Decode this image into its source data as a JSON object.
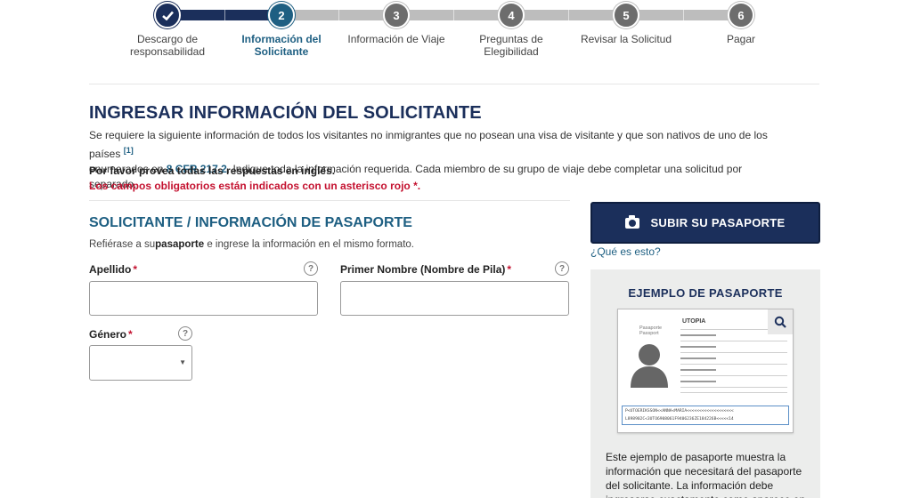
{
  "stepper": {
    "steps": [
      {
        "number": "1",
        "label_line1": "Descargo de",
        "label_line2": "responsabilidad",
        "status": "completed"
      },
      {
        "number": "2",
        "label_line1": "Información del",
        "label_line2": "Solicitante",
        "status": "active"
      },
      {
        "number": "3",
        "label_line1": "Información de Viaje",
        "label_line2": "",
        "status": "pending"
      },
      {
        "number": "4",
        "label_line1": "Preguntas de",
        "label_line2": "Elegibilidad",
        "status": "pending"
      },
      {
        "number": "5",
        "label_line1": "Revisar la Solicitud",
        "label_line2": "",
        "status": "pending"
      },
      {
        "number": "6",
        "label_line1": "Pagar",
        "label_line2": "",
        "status": "pending"
      }
    ],
    "check_icon": "check-icon"
  },
  "intro": {
    "title": "INGRESAR INFORMACIÓN DEL SOLICITANTE",
    "text_part1": "Se requiere la siguiente información de todos los visitantes no inmigrantes que no posean una visa de visitante y que son nativos de uno de los países ",
    "footnote": "[1]",
    "text_part2": " enumerados en ",
    "cfr_link": "8 CFR 217.2",
    "text_part3": ". Indique toda la información requerida. Cada miembro de su grupo de viaje debe completar una solicitud por separado.",
    "english_note": "Por favor provea todas las respuestas en inglés.",
    "required_note": "Los campos obligatorios están indicados con un asterisco rojo *."
  },
  "form": {
    "section_title": "SOLICITANTE / INFORMACIÓN DE PASAPORTE",
    "refer_part1": "Refiérase a su",
    "refer_bold": "pasaporte",
    "refer_part2": " e ingrese la información en el mismo formato.",
    "surname_label": "Apellido",
    "surname_value": "",
    "given_name_label": "Primer Nombre (Nombre de Pila)",
    "given_name_value": "",
    "gender_label": "Género",
    "gender_value": "",
    "required_marker": "*",
    "help_glyph": "?"
  },
  "sidebar": {
    "upload_button": "SUBIR SU PASAPORTE",
    "what_is_this": "¿Qué es esto?",
    "example_title": "EJEMPLO DE PASAPORTE",
    "passport_word": "Pasaporte",
    "passport_word_en": "Passport",
    "passport_country": "UTOPIA",
    "mrz_line1": "P<UTOERIKSSON<<ANNA<MARIA<<<<<<<<<<<<<<<<<<<",
    "mrz_line2": "L898902C<3UTO6908061F9406236ZE184226B<<<<<14",
    "example_text": "Este ejemplo de pasaporte muestra la información que necesitará del pasaporte del solicitante. La información debe ingresarse exactamente como aparece en el pasaporte."
  },
  "colors": {
    "navy": "#1b2f5b",
    "teal": "#1e5f82",
    "required_red": "#c41230",
    "pending_gray": "#6d6d6d"
  }
}
